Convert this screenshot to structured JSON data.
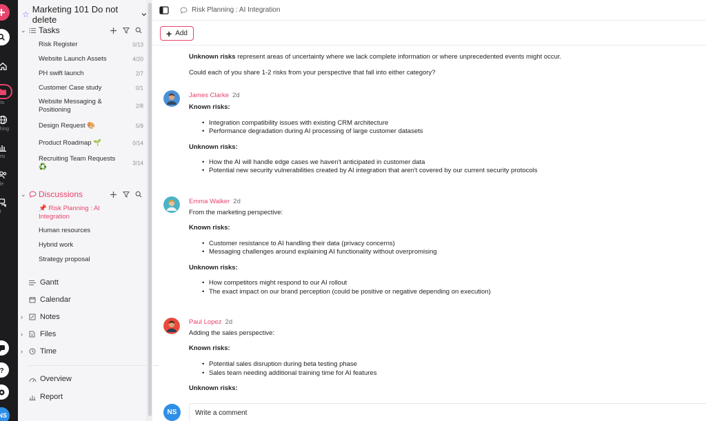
{
  "rail": {
    "labels": [
      "ls",
      "jects",
      "rything",
      "ports",
      "ople",
      "hat"
    ],
    "avatar": "NS"
  },
  "sidebar": {
    "workspace": "Marketing 101 Do not delete",
    "tasks": {
      "title": "Tasks",
      "items": [
        {
          "label": "Risk Register",
          "count": "0/13"
        },
        {
          "label": "Website Launch Assets",
          "count": "4/20"
        },
        {
          "label": "PH swift launch",
          "count": "2/7"
        },
        {
          "label": "Customer Case study",
          "count": "0/1"
        },
        {
          "label": "Website Messaging & Positioning",
          "count": "2/8"
        },
        {
          "label": "Design Request",
          "count": "5/9",
          "emoji": "🎨"
        },
        {
          "label": "Product Roadmap",
          "count": "0/14",
          "emoji": "🌱"
        },
        {
          "label": "Recruiting Team Requests",
          "count": "3/14",
          "emoji": "♻️"
        }
      ]
    },
    "discussions": {
      "title": "Discussions",
      "items": [
        {
          "label": "Risk Planning : AI Integration",
          "active": true
        },
        {
          "label": "Human resources"
        },
        {
          "label": "Hybrid work"
        },
        {
          "label": "Strategy proposal"
        }
      ]
    },
    "nav": {
      "gantt": "Gantt",
      "calendar": "Calendar",
      "notes": "Notes",
      "files": "Files",
      "time": "Time",
      "overview": "Overview",
      "report": "Report"
    }
  },
  "topbar": {
    "breadcrumb": "Risk Planning : AI Integration"
  },
  "toolbar": {
    "add_label": "Add"
  },
  "thread": {
    "intro": {
      "unknown_bold": "Unknown risks",
      "unknown_rest": " represent areas of uncertainty where we lack complete information or where unprecedented events might occur.",
      "question": "Could each of you share 1-2 risks from your perspective that fall into either category?"
    },
    "known_heading": "Known risks:",
    "unknown_heading": "Unknown risks:",
    "posts": [
      {
        "author": "James Clarke",
        "time": "2d",
        "known": [
          "Integration compatibility issues with existing CRM architecture",
          "Performance degradation during AI processing of large customer datasets"
        ],
        "unknown": [
          "How the AI will handle edge cases we haven't anticipated in customer data",
          "Potential new security vulnerabilities created by AI integration that aren't covered by our current security protocols"
        ]
      },
      {
        "author": "Emma Walker",
        "time": "2d",
        "intro": "From the marketing perspective:",
        "known": [
          "Customer resistance to AI handling their data (privacy concerns)",
          "Messaging challenges around explaining AI functionality without overpromising"
        ],
        "unknown": [
          "How competitors might respond to our AI rollout",
          "The exact impact on our brand perception (could be positive or negative depending on execution)"
        ]
      },
      {
        "author": "Paul Lopez",
        "time": "2d",
        "intro": "Adding the sales perspective:",
        "known": [
          "Potential sales disruption during beta testing phase",
          "Sales team needing additional training time for AI features"
        ]
      }
    ]
  },
  "comment": {
    "avatar": "NS",
    "placeholder": "Write a comment"
  },
  "colors": {
    "accent": "#e8436c",
    "rail": "#1c1c1e",
    "sidebar": "#f5f5f7",
    "avatar_blue": "#2f8fe8"
  }
}
